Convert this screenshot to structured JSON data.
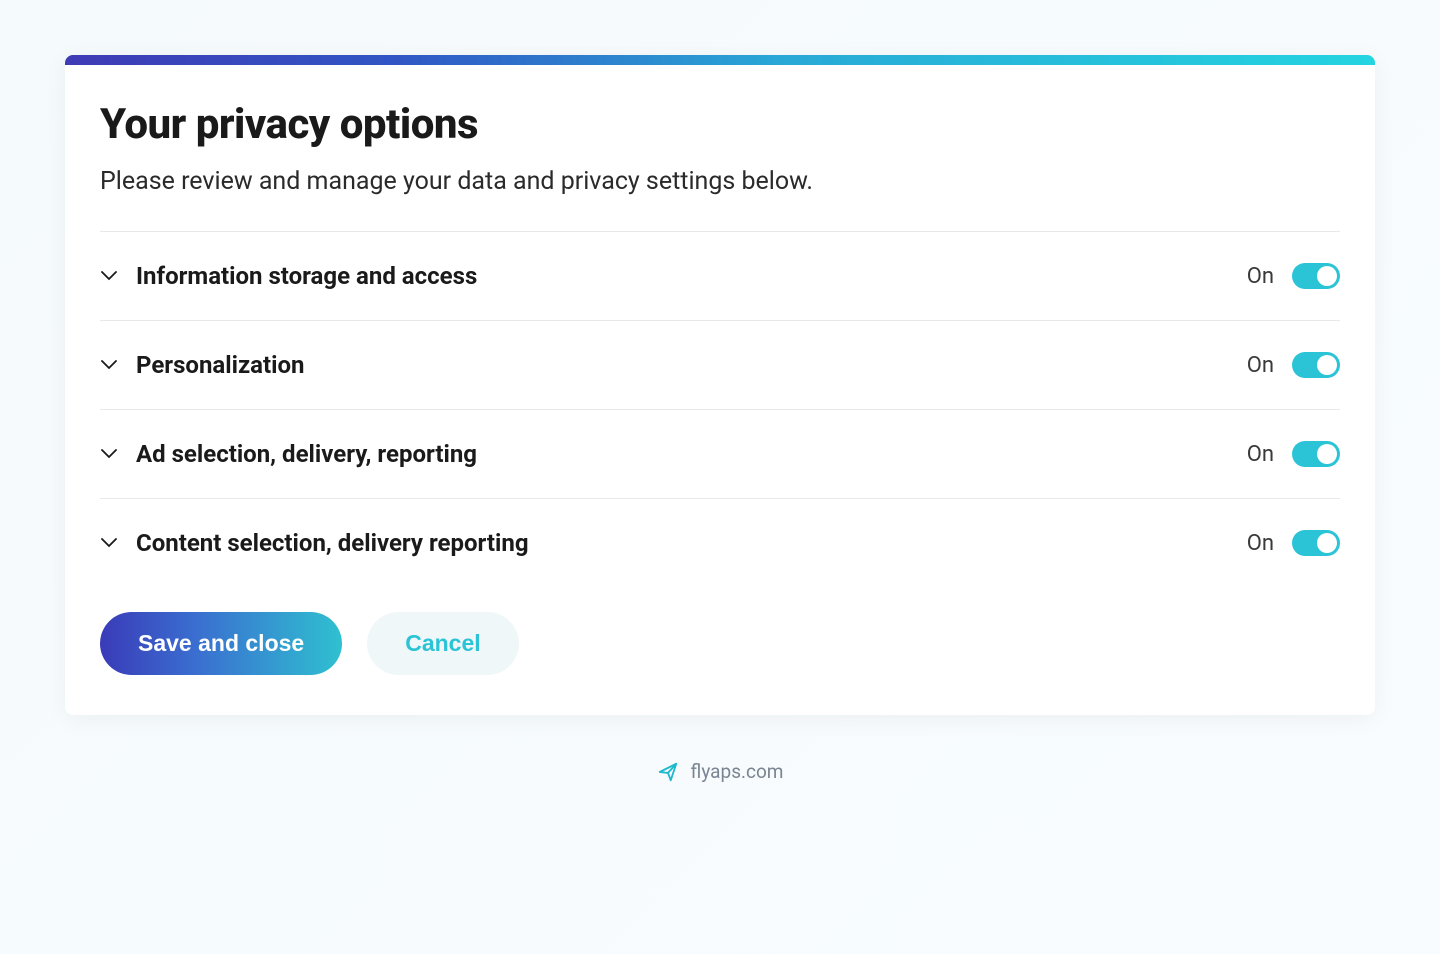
{
  "modal": {
    "title": "Your privacy options",
    "subtitle": "Please review and manage your data and privacy settings below."
  },
  "options": [
    {
      "label": "Information storage and access",
      "state": "On"
    },
    {
      "label": "Personalization",
      "state": "On"
    },
    {
      "label": "Ad selection, delivery, reporting",
      "state": "On"
    },
    {
      "label": "Content selection, delivery reporting",
      "state": "On"
    }
  ],
  "buttons": {
    "save": "Save and close",
    "cancel": "Cancel"
  },
  "footer": {
    "brand": "flyaps.com"
  }
}
